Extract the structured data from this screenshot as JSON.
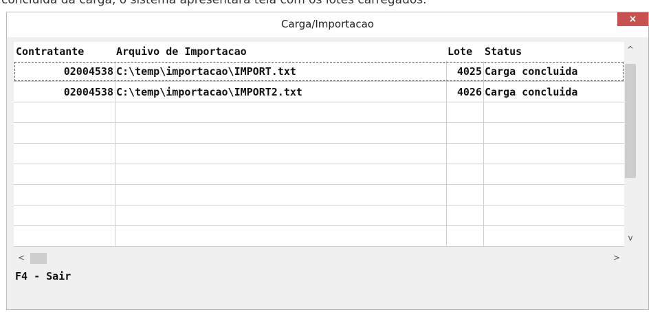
{
  "background_text": "concluída da carga, o sistema apresentará tela com os lotes carregados.",
  "window": {
    "title": "Carga/Importacao",
    "close_label": "×"
  },
  "grid": {
    "columns": [
      "Contratante",
      "Arquivo de Importacao",
      "Lote",
      "Status"
    ],
    "rows": [
      {
        "contratante": "02004538",
        "arquivo": "C:\\temp\\importacao\\IMPORT.txt",
        "lote": "4025",
        "status": "Carga concluida"
      },
      {
        "contratante": "02004538",
        "arquivo": "C:\\temp\\importacao\\IMPORT2.txt",
        "lote": "4026",
        "status": "Carga concluida"
      }
    ],
    "empty_rows": 8
  },
  "scrollbars": {
    "up": "^",
    "down": "v",
    "left": "<",
    "right": ">"
  },
  "footer": {
    "hint": "F4 - Sair"
  },
  "colors": {
    "close_button": "#c75050",
    "grid_line": "#cfcfcf",
    "window_bg": "#f0f0f0"
  }
}
